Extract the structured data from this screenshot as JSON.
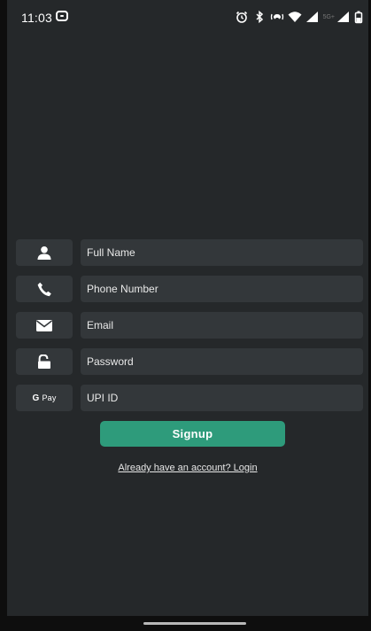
{
  "status_bar": {
    "time": "11:03",
    "network_label": "5G+"
  },
  "form": {
    "full_name_placeholder": "Full Name",
    "phone_placeholder": "Phone Number",
    "email_placeholder": "Email",
    "password_placeholder": "Password",
    "upi_placeholder": "UPI ID",
    "gpay_bold": "G",
    "gpay_text": "Pay"
  },
  "actions": {
    "signup_label": "Signup",
    "login_link": "Already have an account? Login"
  },
  "colors": {
    "background": "#25282a",
    "field_background": "#33373a",
    "accent": "#2e9b7b"
  },
  "icons": {
    "full_name": "person-icon",
    "phone": "phone-icon",
    "email": "envelope-icon",
    "password": "unlock-icon",
    "upi": "gpay-logo"
  }
}
